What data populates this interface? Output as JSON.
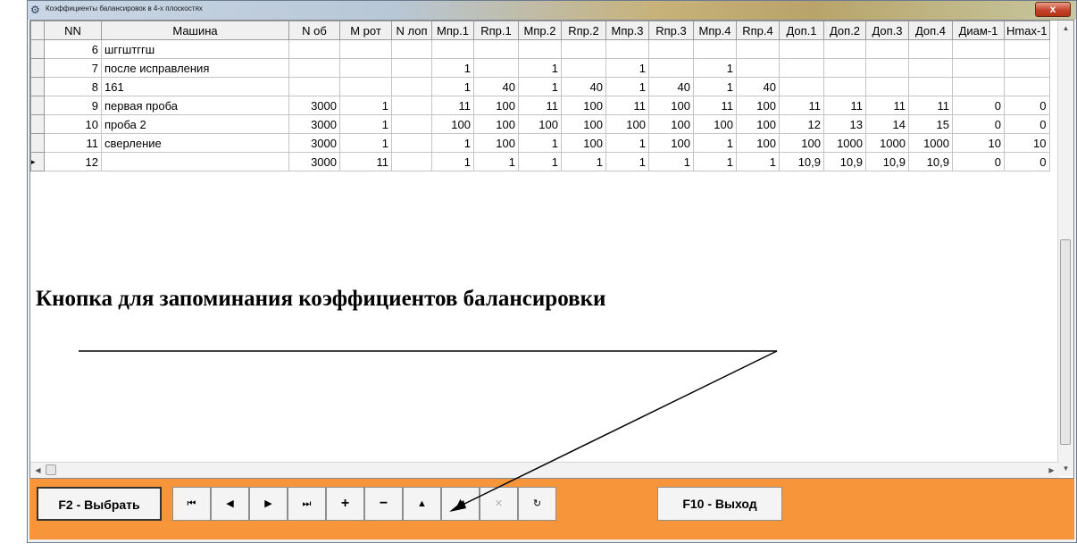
{
  "window": {
    "title": "Коэффициенты балансировок в 4-х плоскостях",
    "close_label": "x"
  },
  "grid": {
    "columns": [
      "NN",
      "Машина",
      "N об",
      "М рот",
      "N лоп",
      "Мпр.1",
      "Rпр.1",
      "Мпр.2",
      "Rпр.2",
      "Мпр.3",
      "Rпр.3",
      "Мпр.4",
      "Rпр.4",
      "Доп.1",
      "Доп.2",
      "Доп.3",
      "Доп.4",
      "Диам-1",
      "Hmax-1"
    ],
    "rows": [
      {
        "nn": "6",
        "name": "шггштггш",
        "cells": [
          "",
          "",
          "",
          "",
          "",
          "",
          "",
          "",
          "",
          "",
          "",
          "",
          "",
          "",
          "",
          "",
          "",
          ""
        ]
      },
      {
        "nn": "7",
        "name": "после исправления",
        "cells": [
          "",
          "",
          "",
          "1",
          "",
          "1",
          "",
          "1",
          "",
          "1",
          "",
          "",
          "",
          "",
          "",
          "",
          ""
        ]
      },
      {
        "nn": "8",
        "name": "161",
        "cells": [
          "",
          "",
          "",
          "1",
          "40",
          "1",
          "40",
          "1",
          "40",
          "1",
          "40",
          "",
          "",
          "",
          "",
          "",
          ""
        ]
      },
      {
        "nn": "9",
        "name": "первая проба",
        "cells": [
          "3000",
          "1",
          "",
          "11",
          "100",
          "11",
          "100",
          "11",
          "100",
          "11",
          "100",
          "11",
          "11",
          "11",
          "11",
          "0",
          "0"
        ]
      },
      {
        "nn": "10",
        "name": "проба 2",
        "cells": [
          "3000",
          "1",
          "",
          "100",
          "100",
          "100",
          "100",
          "100",
          "100",
          "100",
          "100",
          "12",
          "13",
          "14",
          "15",
          "0",
          "0"
        ]
      },
      {
        "nn": "11",
        "name": "сверление",
        "cells": [
          "3000",
          "1",
          "",
          "1",
          "100",
          "1",
          "100",
          "1",
          "100",
          "1",
          "100",
          "100",
          "1000",
          "1000",
          "1000",
          "10",
          "10"
        ]
      },
      {
        "nn": "12",
        "name": "",
        "cells": [
          "3000",
          "11",
          "",
          "1",
          "1",
          "1",
          "1",
          "1",
          "1",
          "1",
          "1",
          "10,9",
          "10,9",
          "10,9",
          "10,9",
          "0",
          "0"
        ]
      }
    ],
    "current_row_marker": "▸"
  },
  "annotation": "Кнопка для запоминания коэффициентов балансировки",
  "toolbar": {
    "select_label": "F2 - Выбрать",
    "exit_label": "F10 - Выход",
    "nav": {
      "first": "⏮",
      "prior": "◀",
      "next": "▶",
      "last": "⏭",
      "insert": "+",
      "delete": "−",
      "edit": "▲",
      "post": "▲",
      "cancel": "✕",
      "refresh": "↻"
    }
  },
  "colors": {
    "toolbar_bg": "#f7953b",
    "grid_line": "#c4c4c4",
    "header_bg": "#f0f0f0"
  }
}
